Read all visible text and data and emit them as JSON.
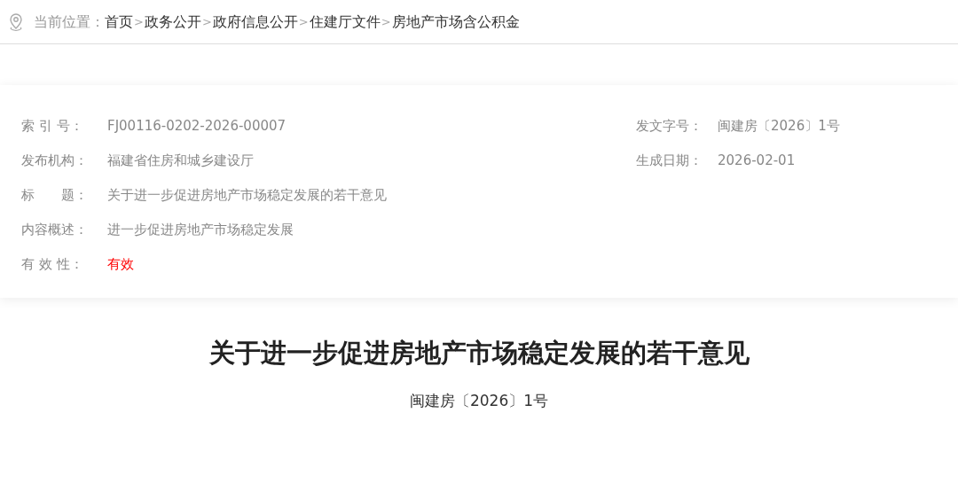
{
  "breadcrumb": {
    "label": "当前位置：",
    "separator": ">",
    "items": [
      "首页",
      "政务公开",
      "政府信息公开",
      "住建厅文件",
      "房地产市场含公积金"
    ]
  },
  "info": {
    "left": [
      {
        "label": "索 引 号：",
        "value": "FJ00116-0202-2026-00007"
      },
      {
        "label": "发布机构：",
        "value": "福建省住房和城乡建设厅"
      },
      {
        "label": "标　　题：",
        "value": "关于进一步促进房地产市场稳定发展的若干意见"
      },
      {
        "label": "内容概述：",
        "value": "进一步促进房地产市场稳定发展"
      },
      {
        "label": "有 效 性：",
        "value": "有效",
        "kind": "status"
      }
    ],
    "right": [
      {
        "label": "发文字号：",
        "value": "闽建房〔2026〕1号"
      },
      {
        "label": "生成日期：",
        "value": "2026-02-01"
      }
    ]
  },
  "article": {
    "title": "关于进一步促进房地产市场稳定发展的若干意见",
    "doc_number": "闽建房〔2026〕1号"
  }
}
